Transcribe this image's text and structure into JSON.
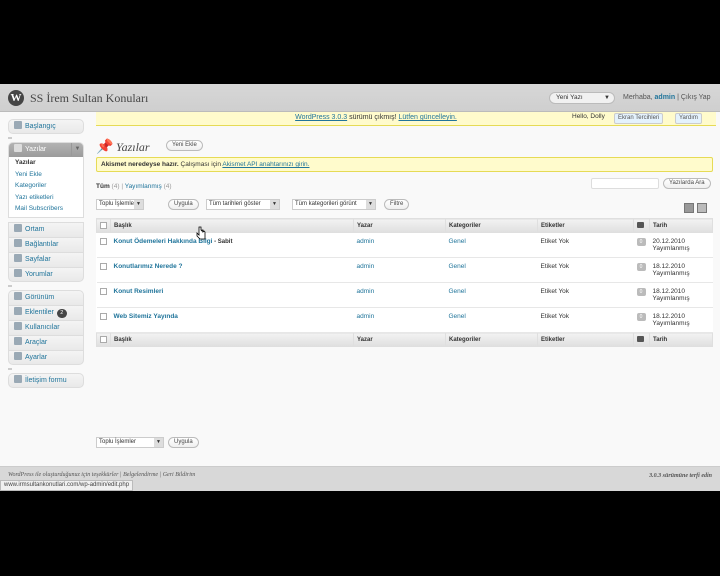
{
  "header": {
    "logo": "W",
    "site_title": "SS İrem Sultan Konuları",
    "favorite_action": "Yeni Yazı",
    "greeting_prefix": "Merhaba,",
    "user": "admin",
    "logout": "Çıkış Yap"
  },
  "update_notice": {
    "link1": "WordPress 3.0.3",
    "text": " sürümü çıkmış! ",
    "link2": "Lütfen güncelleyin."
  },
  "hello_dolly": "Hello, Dolly",
  "screen_options": "Ekran Tercihleri",
  "help": "Yardım",
  "menu": {
    "dashboard": "Başlangıç",
    "posts": "Yazılar",
    "posts_sub": [
      "Yazılar",
      "Yeni Ekle",
      "Kategoriler",
      "Yazı etiketleri",
      "Mail Subscribers"
    ],
    "media": "Ortam",
    "links": "Bağlantılar",
    "pages": "Sayfalar",
    "comments": "Yorumlar",
    "appearance": "Görünüm",
    "plugins": "Eklentiler",
    "plugins_count": "2",
    "users": "Kullanıcılar",
    "tools": "Araçlar",
    "settings": "Ayarlar",
    "contact_form": "İletişim formu"
  },
  "page": {
    "title": "Yazılar",
    "add_new": "Yeni Ekle",
    "akismet_bold": "Akismet neredeyse hazır.",
    "akismet_text": " Çalışması için ",
    "akismet_link": "Akismet API anahtarınızı girin.",
    "filter_all": "Tüm",
    "filter_all_count": "(4)",
    "filter_sep": "|",
    "filter_published": "Yayımlanmış",
    "filter_published_count": "(4)",
    "search_button": "Yazılarda Ara",
    "bulk_actions": "Toplu İşlemler",
    "apply": "Uygula",
    "all_dates": "Tüm tarihleri göster",
    "all_categories": "Tüm kategorileri görünt",
    "filter_button": "Filtre"
  },
  "table": {
    "headers": [
      "Başlık",
      "Yazar",
      "Kategoriler",
      "Etiketler",
      "Tarih"
    ],
    "rows": [
      {
        "title": "Konut Ödemeleri Hakkında Bilgi",
        "state": " - Sabit",
        "author": "admin",
        "category": "Genel",
        "tags": "Etiket Yok",
        "comments": "0",
        "date": "20.12.2010",
        "status": "Yayımlanmış"
      },
      {
        "title": "Konutlarımız Nerede ?",
        "state": "",
        "author": "admin",
        "category": "Genel",
        "tags": "Etiket Yok",
        "comments": "0",
        "date": "18.12.2010",
        "status": "Yayımlanmış"
      },
      {
        "title": "Konut Resimleri",
        "state": "",
        "author": "admin",
        "category": "Genel",
        "tags": "Etiket Yok",
        "comments": "0",
        "date": "18.12.2010",
        "status": "Yayımlanmış"
      },
      {
        "title": "Web Sitemiz Yayında",
        "state": "",
        "author": "admin",
        "category": "Genel",
        "tags": "Etiket Yok",
        "comments": "0",
        "date": "18.12.2010",
        "status": "Yayımlanmış"
      }
    ]
  },
  "footer": {
    "left": "WordPress ile oluşturduğunuz için teşekkürler | Belgelendirme | Geri Bildirim",
    "right": "3.0.3 sürümüne terfi edin",
    "status_url": "www.irmsultankonutlari.com/wp-admin/edit.php"
  },
  "colors": {
    "link": "#21759b",
    "notice_bg": "#fffbcc",
    "menu_current": "#9b9b9b"
  }
}
